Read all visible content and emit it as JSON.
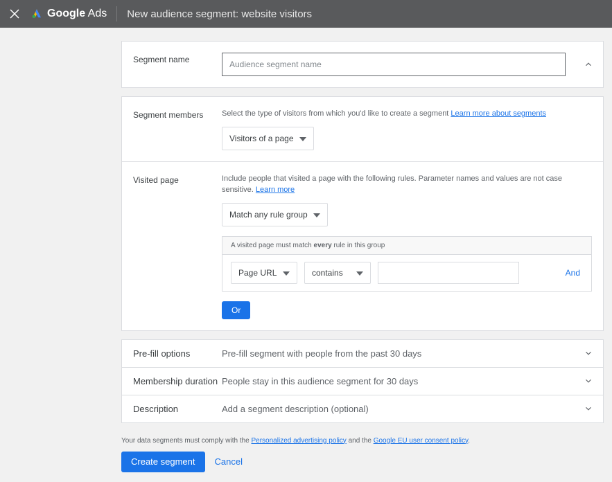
{
  "header": {
    "brand_bold": "Google",
    "brand_rest": " Ads",
    "page_title": "New audience segment: website visitors"
  },
  "segment_name": {
    "label": "Segment name",
    "placeholder": "Audience segment name",
    "value": ""
  },
  "segment_members": {
    "label": "Segment members",
    "helper": "Select the type of visitors from which you'd like to create a segment ",
    "learn_more": "Learn more about segments",
    "dropdown": "Visitors of a page"
  },
  "visited_page": {
    "label": "Visited page",
    "helper": "Include people that visited a page with the following rules. Parameter names and values are not case sensitive. ",
    "learn_more": "Learn more",
    "match_dropdown": "Match any rule group",
    "group_header_pre": "A visited page must match ",
    "group_header_bold": "every",
    "group_header_post": " rule in this group",
    "rule_field": "Page URL",
    "rule_op": "contains",
    "rule_value": "",
    "and": "And",
    "or": "Or"
  },
  "prefill": {
    "label": "Pre-fill options",
    "summary": "Pre-fill segment with people from the past 30 days"
  },
  "membership": {
    "label": "Membership duration",
    "summary": "People stay in this audience segment for 30 days"
  },
  "description": {
    "label": "Description",
    "summary": "Add a segment description (optional)"
  },
  "footer": {
    "note_pre": "Your data segments must comply with the ",
    "link1": "Personalized advertising policy",
    "note_mid": " and the ",
    "link2": "Google EU user consent policy",
    "note_post": ".",
    "create": "Create segment",
    "cancel": "Cancel"
  }
}
